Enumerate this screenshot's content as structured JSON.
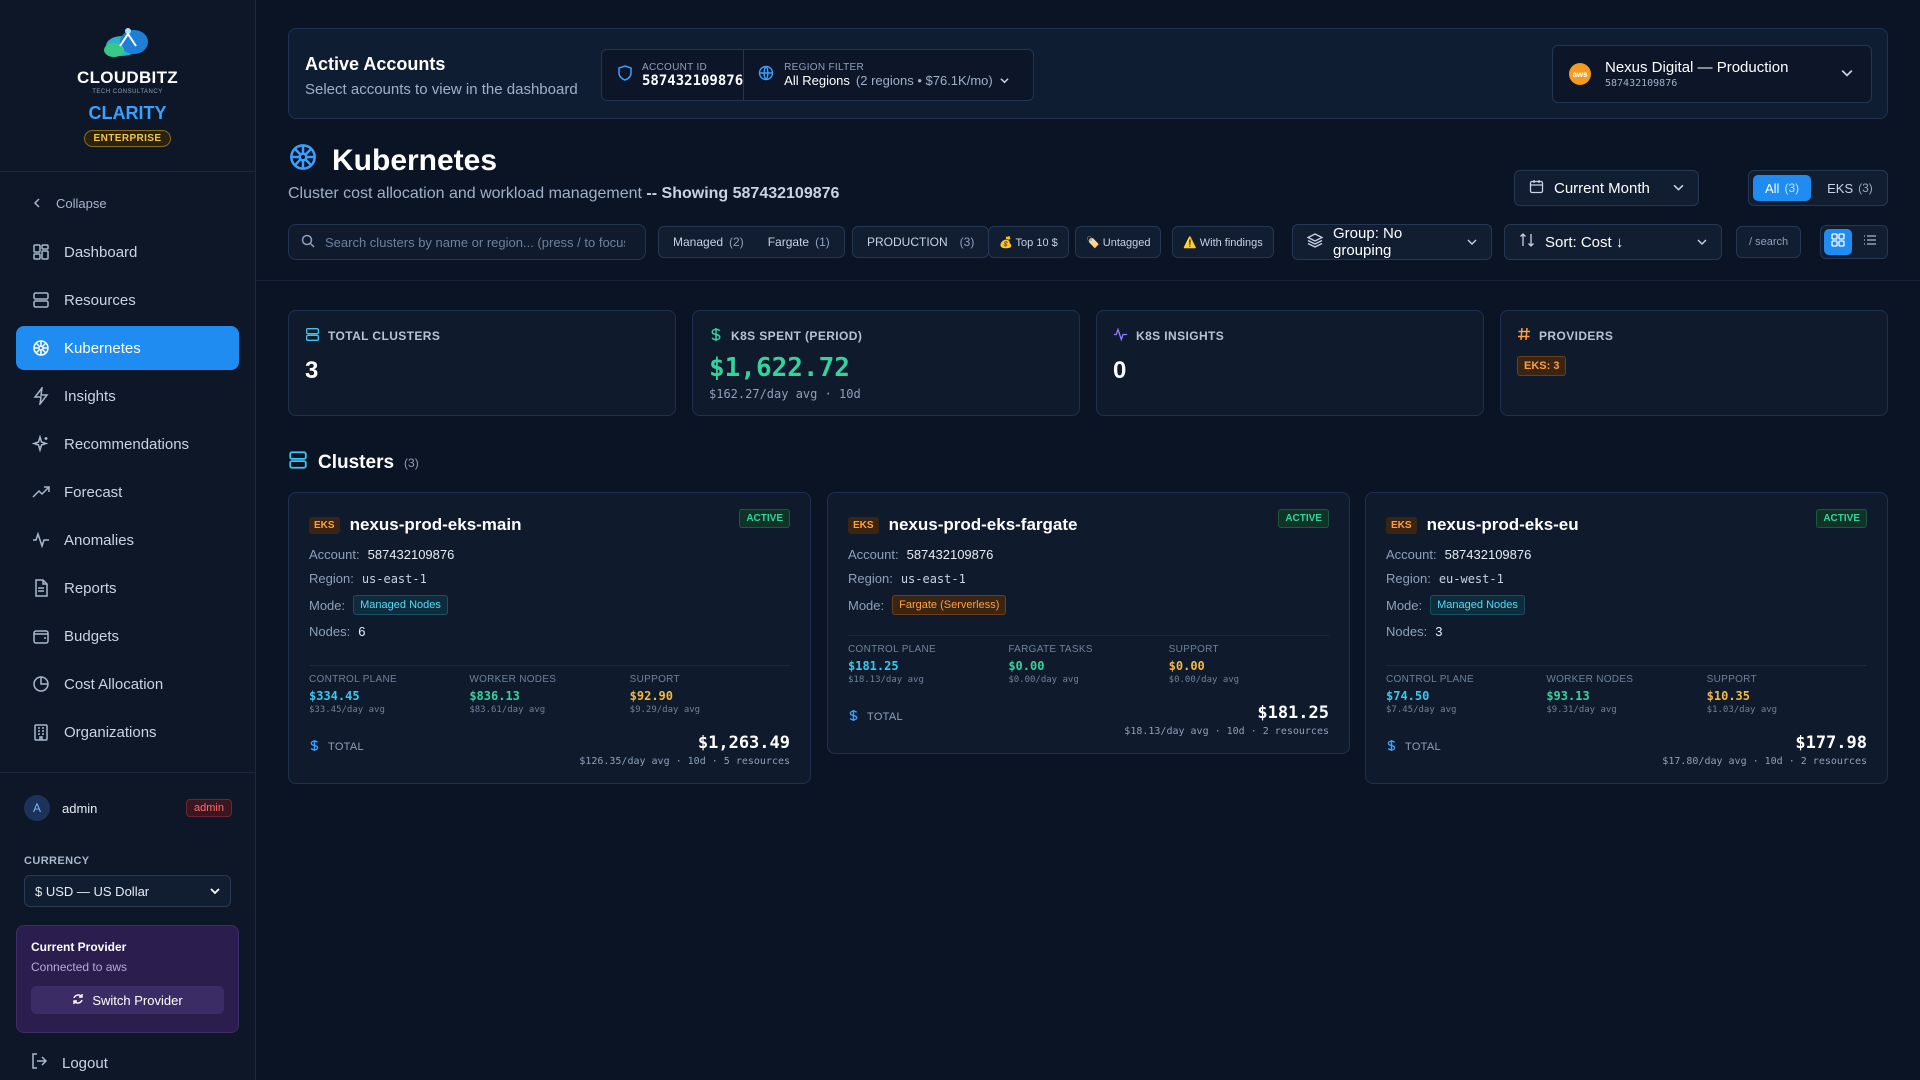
{
  "sidebar": {
    "brand": {
      "name": "CLOUDBITZ",
      "sub": "TECH CONSULTANCY",
      "product": "CLARITY",
      "tier": "ENTERPRISE"
    },
    "collapse_label": "Collapse",
    "items": [
      {
        "label": "Dashboard",
        "icon": "dashboard-icon"
      },
      {
        "label": "Resources",
        "icon": "server-icon"
      },
      {
        "label": "Kubernetes",
        "icon": "kubernetes-icon",
        "active": true
      },
      {
        "label": "Insights",
        "icon": "lightning-icon"
      },
      {
        "label": "Recommendations",
        "icon": "sparkle-icon"
      },
      {
        "label": "Forecast",
        "icon": "trend-icon"
      },
      {
        "label": "Anomalies",
        "icon": "pulse-icon"
      },
      {
        "label": "Reports",
        "icon": "document-icon"
      },
      {
        "label": "Budgets",
        "icon": "wallet-icon"
      },
      {
        "label": "Cost Allocation",
        "icon": "pie-icon"
      },
      {
        "label": "Organizations",
        "icon": "building-icon"
      }
    ],
    "user": {
      "avatar": "A",
      "name": "admin",
      "role": "admin"
    },
    "currency_label": "CURRENCY",
    "currency_value": "$ USD — US Dollar",
    "provider": {
      "title": "Current Provider",
      "sub": "Connected to aws",
      "button": "Switch Provider"
    },
    "logout": "Logout"
  },
  "topbar": {
    "title": "Active Accounts",
    "subtitle": "Select accounts to view in the dashboard",
    "account_label": "ACCOUNT ID",
    "account_id": "587432109876",
    "region_label": "REGION FILTER",
    "region_value": "All Regions",
    "region_detail": "(2 regions • $76.1K/mo)",
    "org_logo": "aws",
    "org_name": "Nexus Digital — Production",
    "org_id": "587432109876"
  },
  "page": {
    "title": "Kubernetes",
    "subtitle": "Cluster cost allocation and workload management",
    "showing": "-- Showing 587432109876",
    "period": "Current Month",
    "toggle": [
      {
        "label": "All",
        "count": "(3)",
        "active": true
      },
      {
        "label": "EKS",
        "count": "(3)",
        "active": false
      }
    ]
  },
  "filters": {
    "search_placeholder": "Search clusters by name or region... (press / to focus)",
    "managed": {
      "label": "Managed",
      "count": "(2)"
    },
    "fargate": {
      "label": "Fargate",
      "count": "(1)"
    },
    "production": {
      "label": "PRODUCTION",
      "count": "(3)"
    },
    "top10": "💰 Top 10 $",
    "untagged": "🏷️ Untagged",
    "findings": "⚠️ With findings",
    "group": "Group: No grouping",
    "sort": "Sort: Cost ↓",
    "search_hint": "/  search"
  },
  "stats": [
    {
      "label": "TOTAL CLUSTERS",
      "value": "3",
      "icon": "server-icon"
    },
    {
      "label": "K8S SPENT (PERIOD)",
      "value": "$1,622.72",
      "foot": "$162.27/day avg · 10d",
      "icon": "dollar-icon"
    },
    {
      "label": "K8S INSIGHTS",
      "value": "0",
      "icon": "pulse-icon"
    },
    {
      "label": "PROVIDERS",
      "badge": "EKS: 3",
      "icon": "hash-icon"
    }
  ],
  "clusters_header": {
    "title": "Clusters",
    "count": "(3)"
  },
  "clusters": [
    {
      "tag": "EKS",
      "name": "nexus-prod-eks-main",
      "status": "ACTIVE",
      "account_label": "Account:",
      "account": "587432109876",
      "region_label": "Region:",
      "region": "us-east-1",
      "mode_label": "Mode:",
      "mode": "Managed Nodes",
      "nodes_label": "Nodes:",
      "nodes": "6",
      "costs": [
        {
          "label": "CONTROL PLANE",
          "value": "$334.45",
          "sub": "$33.45/day avg"
        },
        {
          "label": "WORKER NODES",
          "value": "$836.13",
          "sub": "$83.61/day avg"
        },
        {
          "label": "SUPPORT",
          "value": "$92.90",
          "sub": "$9.29/day avg"
        }
      ],
      "total_label": "TOTAL",
      "total": "$1,263.49",
      "total_sub": "$126.35/day avg · 10d · 5 resources"
    },
    {
      "tag": "EKS",
      "name": "nexus-prod-eks-fargate",
      "status": "ACTIVE",
      "account_label": "Account:",
      "account": "587432109876",
      "region_label": "Region:",
      "region": "us-east-1",
      "mode_label": "Mode:",
      "mode": "Fargate (Serverless)",
      "costs": [
        {
          "label": "CONTROL PLANE",
          "value": "$181.25",
          "sub": "$18.13/day avg"
        },
        {
          "label": "FARGATE TASKS",
          "value": "$0.00",
          "sub": "$0.00/day avg"
        },
        {
          "label": "SUPPORT",
          "value": "$0.00",
          "sub": "$0.00/day avg"
        }
      ],
      "total_label": "TOTAL",
      "total": "$181.25",
      "total_sub": "$18.13/day avg · 10d · 2 resources"
    },
    {
      "tag": "EKS",
      "name": "nexus-prod-eks-eu",
      "status": "ACTIVE",
      "account_label": "Account:",
      "account": "587432109876",
      "region_label": "Region:",
      "region": "eu-west-1",
      "mode_label": "Mode:",
      "mode": "Managed Nodes",
      "nodes_label": "Nodes:",
      "nodes": "3",
      "costs": [
        {
          "label": "CONTROL PLANE",
          "value": "$74.50",
          "sub": "$7.45/day avg"
        },
        {
          "label": "WORKER NODES",
          "value": "$93.13",
          "sub": "$9.31/day avg"
        },
        {
          "label": "SUPPORT",
          "value": "$10.35",
          "sub": "$1.03/day avg"
        }
      ],
      "total_label": "TOTAL",
      "total": "$177.98",
      "total_sub": "$17.80/day avg · 10d · 2 resources"
    }
  ],
  "colors": {
    "accent": "#1e8cf0",
    "positive": "#34d39e",
    "provider": "#ff9f43",
    "warning": "#f4b942"
  }
}
